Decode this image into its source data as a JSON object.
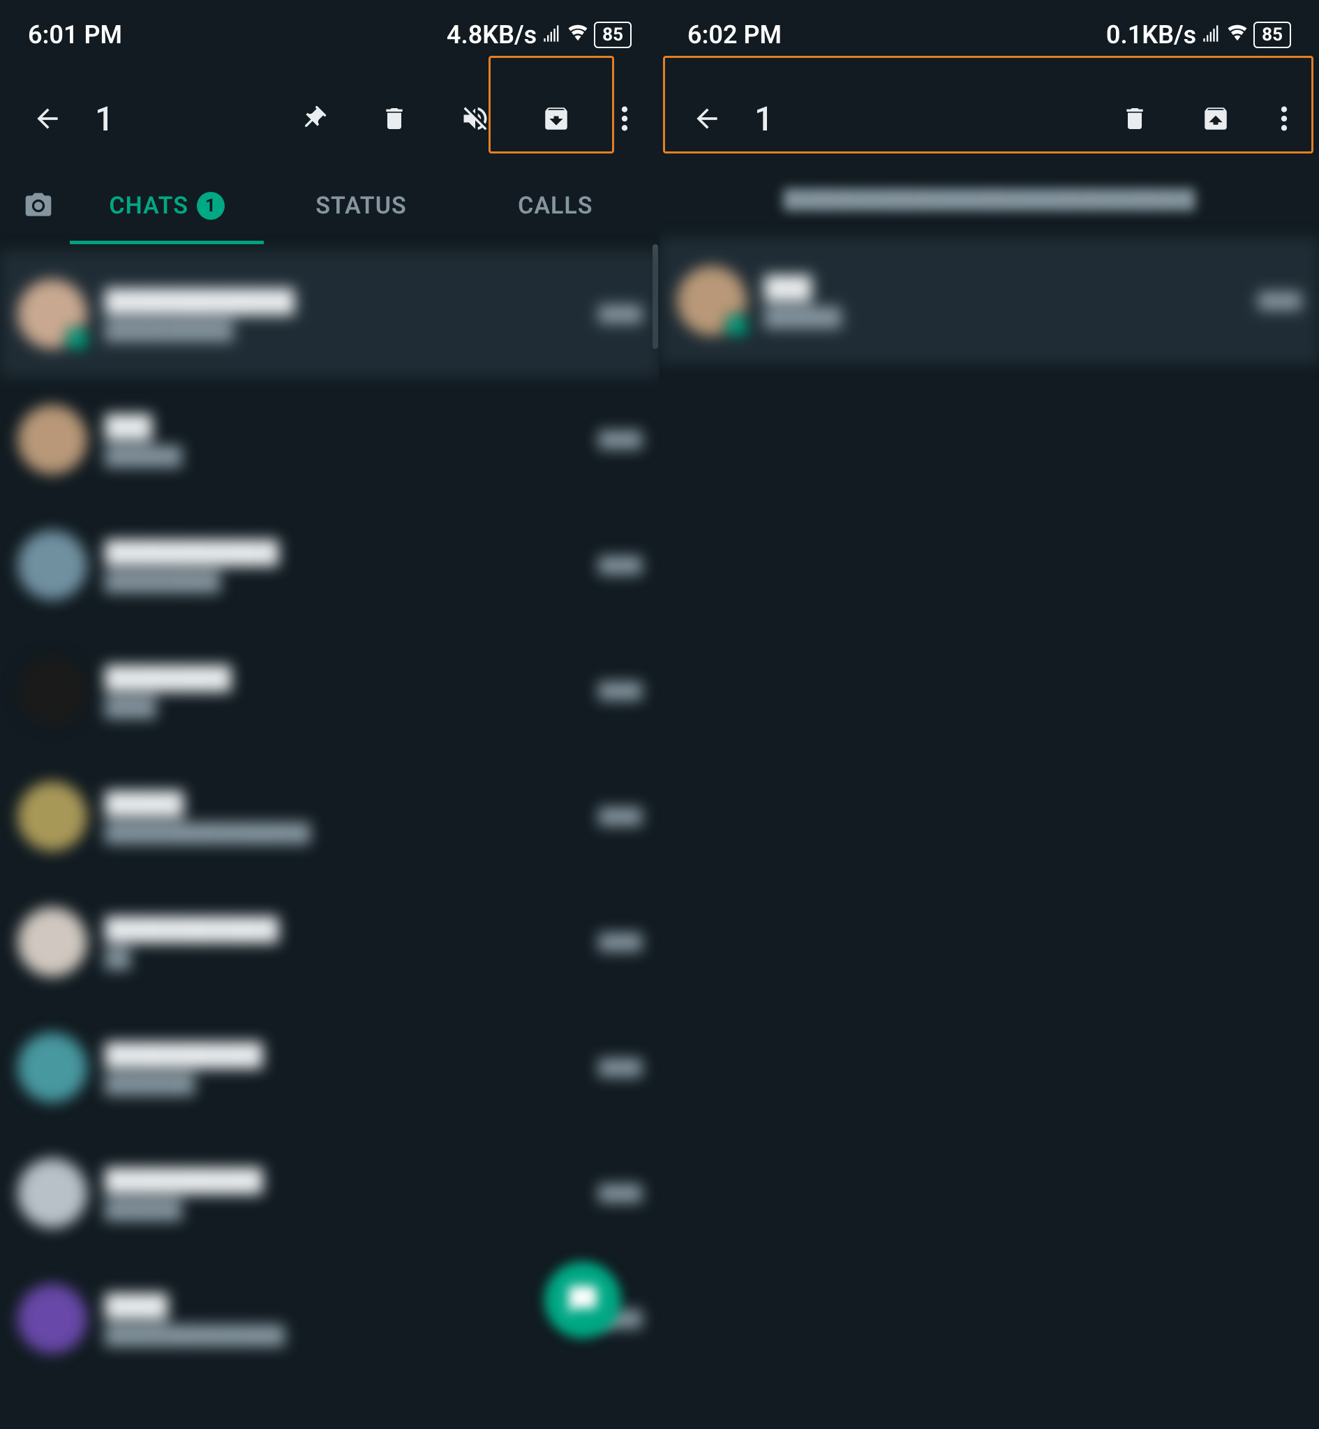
{
  "left": {
    "status": {
      "time": "6:01 PM",
      "speed": "4.8KB/s",
      "battery": "85"
    },
    "actionbar": {
      "count": "1"
    },
    "tabs": {
      "chats": "CHATS",
      "chats_badge": "1",
      "status": "STATUS",
      "calls": "CALLS"
    },
    "chats": [
      {
        "title": "████████████",
        "preview": "██████████",
        "time": "████",
        "selected": true,
        "color": "#c8a890"
      },
      {
        "title": "███",
        "preview": "██████",
        "time": "████",
        "color": "#b89878"
      },
      {
        "title": "███████████",
        "preview": "█████████",
        "time": "████",
        "color": "#7090a0"
      },
      {
        "title": "████████",
        "preview": "████",
        "time": "████",
        "color": "#1a1a1a"
      },
      {
        "title": "█████",
        "preview": "████████████████",
        "time": "████",
        "color": "#a89858"
      },
      {
        "title": "███████████",
        "preview": "██",
        "time": "████",
        "color": "#d0c8c0"
      },
      {
        "title": "██████████",
        "preview": "███████",
        "time": "████",
        "color": "#4898a0"
      },
      {
        "title": "██████████",
        "preview": "██████",
        "time": "████",
        "color": "#b8c0c8"
      },
      {
        "title": "████",
        "preview": "██████████████",
        "time": "████",
        "color": "#6848a8"
      }
    ]
  },
  "right": {
    "status": {
      "time": "6:02 PM",
      "speed": "0.1KB/s",
      "battery": "85"
    },
    "actionbar": {
      "count": "1"
    },
    "archived_note": "████████████████████████████████",
    "chats": [
      {
        "title": "███",
        "preview": "██████",
        "time": "████",
        "selected": true,
        "color": "#b89878"
      }
    ]
  }
}
